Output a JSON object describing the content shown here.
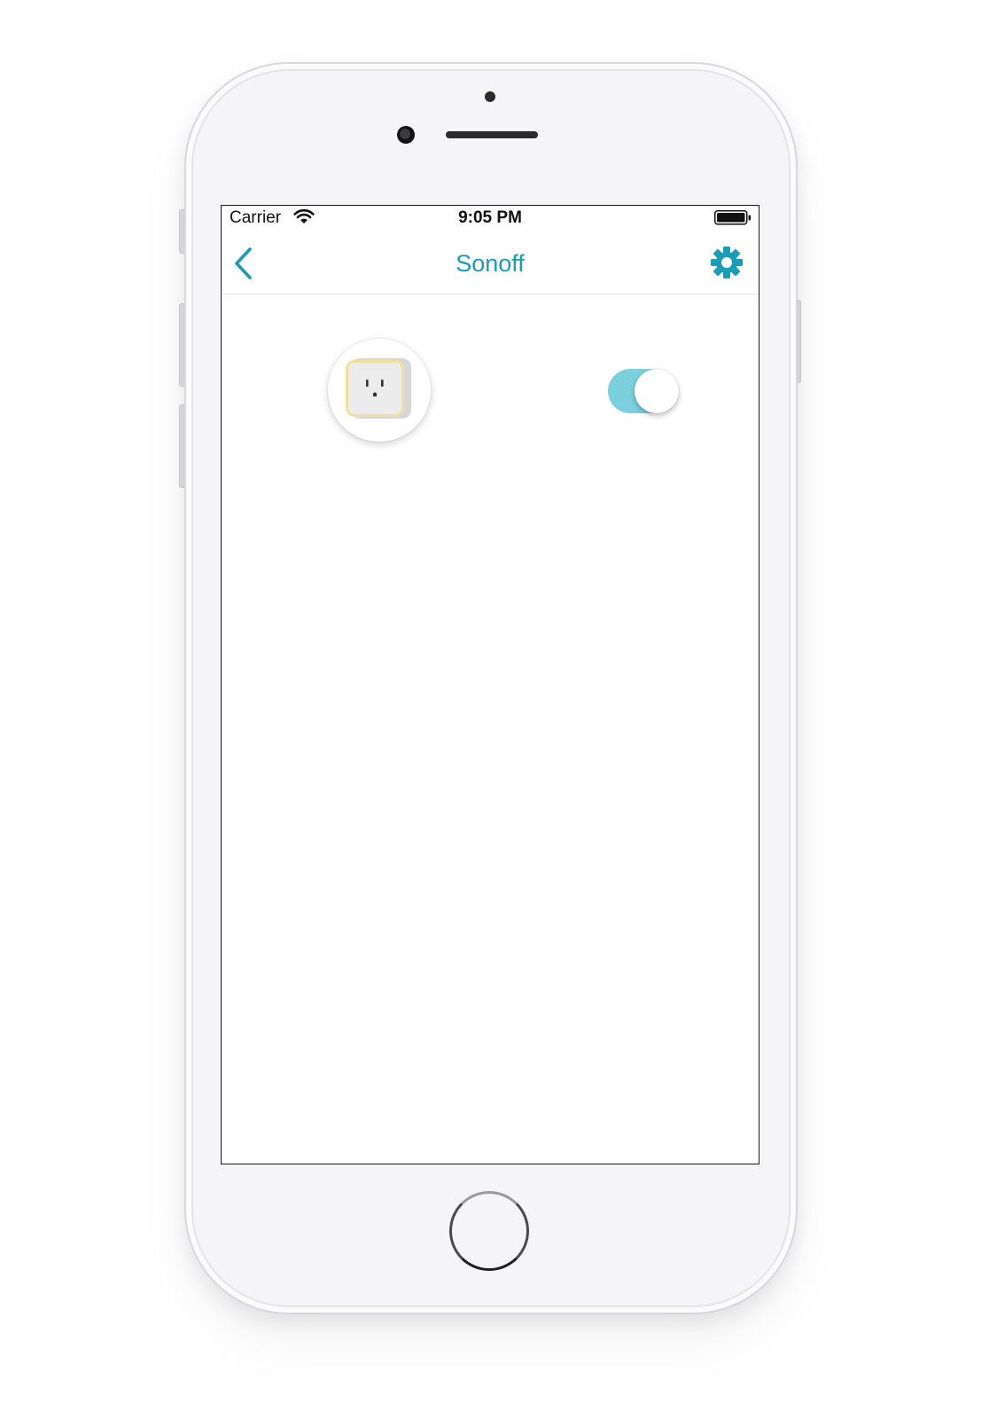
{
  "status_bar": {
    "carrier": "Carrier",
    "time": "9:05 PM",
    "wifi_icon": "wifi-icon",
    "battery_icon": "battery-full-icon"
  },
  "nav": {
    "title": "Sonoff",
    "back_icon": "chevron-left-icon",
    "settings_icon": "gear-icon"
  },
  "device": {
    "icon": "power-outlet-icon",
    "switch_on": true
  },
  "colors": {
    "accent": "#1a9cb6",
    "toggle_track_on": "#7ccfdd",
    "outlet_border": "#f3df9c"
  }
}
